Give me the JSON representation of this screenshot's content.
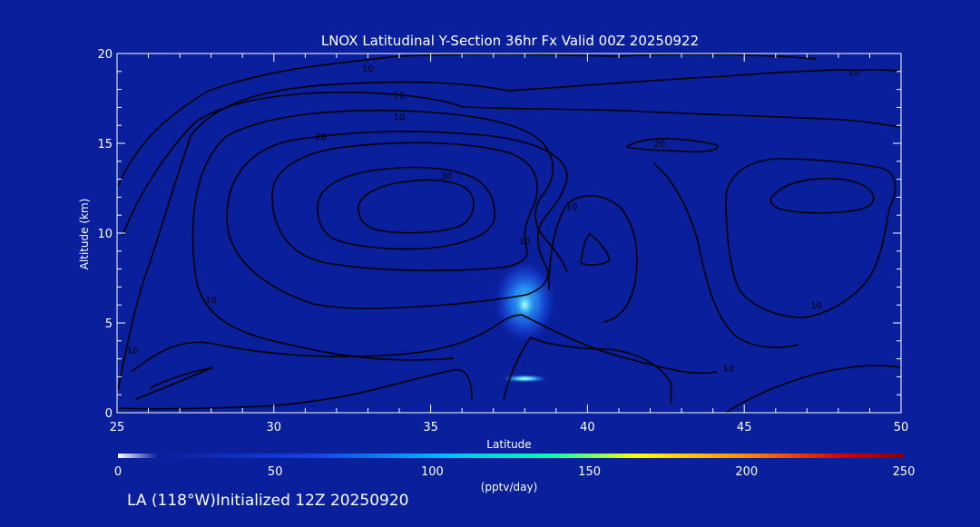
{
  "chart_data": {
    "type": "heatmap",
    "title": "LNOX Latitudinal Y-Section 36hr  Fx Valid 00Z 20250922",
    "xlabel": "Latitude",
    "ylabel": "Altitude (km)",
    "xlim": [
      25,
      50
    ],
    "ylim": [
      0,
      20
    ],
    "x_ticks": [
      "25",
      "30",
      "35",
      "40",
      "45",
      "50"
    ],
    "y_ticks": [
      "0",
      "5",
      "10",
      "15",
      "20"
    ],
    "grid": false,
    "colorbar": {
      "label": "(pptv/day)",
      "range": [
        0,
        250
      ],
      "ticks": [
        "0",
        "50",
        "100",
        "150",
        "200",
        "250"
      ],
      "colors": [
        "#ffffff",
        "#0a1f9c",
        "#00aaff",
        "#00ffaa",
        "#ffff00",
        "#ff8800",
        "#dd0000",
        "#880000"
      ]
    },
    "hotspots": [
      {
        "lat": 38.0,
        "alt": 6.0,
        "value": 75
      },
      {
        "lat": 38.0,
        "alt": 1.9,
        "value": 95
      }
    ],
    "contour_labels": [
      {
        "text": "10",
        "lat": 33.0,
        "alt": 19.0
      },
      {
        "text": "10",
        "lat": 48.5,
        "alt": 18.8
      },
      {
        "text": "10",
        "lat": 34.0,
        "alt": 17.5
      },
      {
        "text": "10",
        "lat": 34.0,
        "alt": 16.3
      },
      {
        "text": "20",
        "lat": 31.5,
        "alt": 15.2
      },
      {
        "text": "30",
        "lat": 35.5,
        "alt": 13.0
      },
      {
        "text": "10",
        "lat": 39.5,
        "alt": 11.3
      },
      {
        "text": "10",
        "lat": 38.0,
        "alt": 9.4
      },
      {
        "text": "10",
        "lat": 28.0,
        "alt": 6.1
      },
      {
        "text": "20",
        "lat": 42.3,
        "alt": 14.8
      },
      {
        "text": "10",
        "lat": 47.3,
        "alt": 5.8
      },
      {
        "text": "10",
        "lat": 25.5,
        "alt": 3.3
      },
      {
        "text": "10",
        "lat": 44.5,
        "alt": 2.3
      }
    ]
  },
  "footer": {
    "location": "LA (118°W)",
    "initialized": "Initialized 12Z 20250920"
  },
  "colors": {
    "background": "#0a1f9c",
    "axis": "#ffffff",
    "contour": "#000000"
  }
}
